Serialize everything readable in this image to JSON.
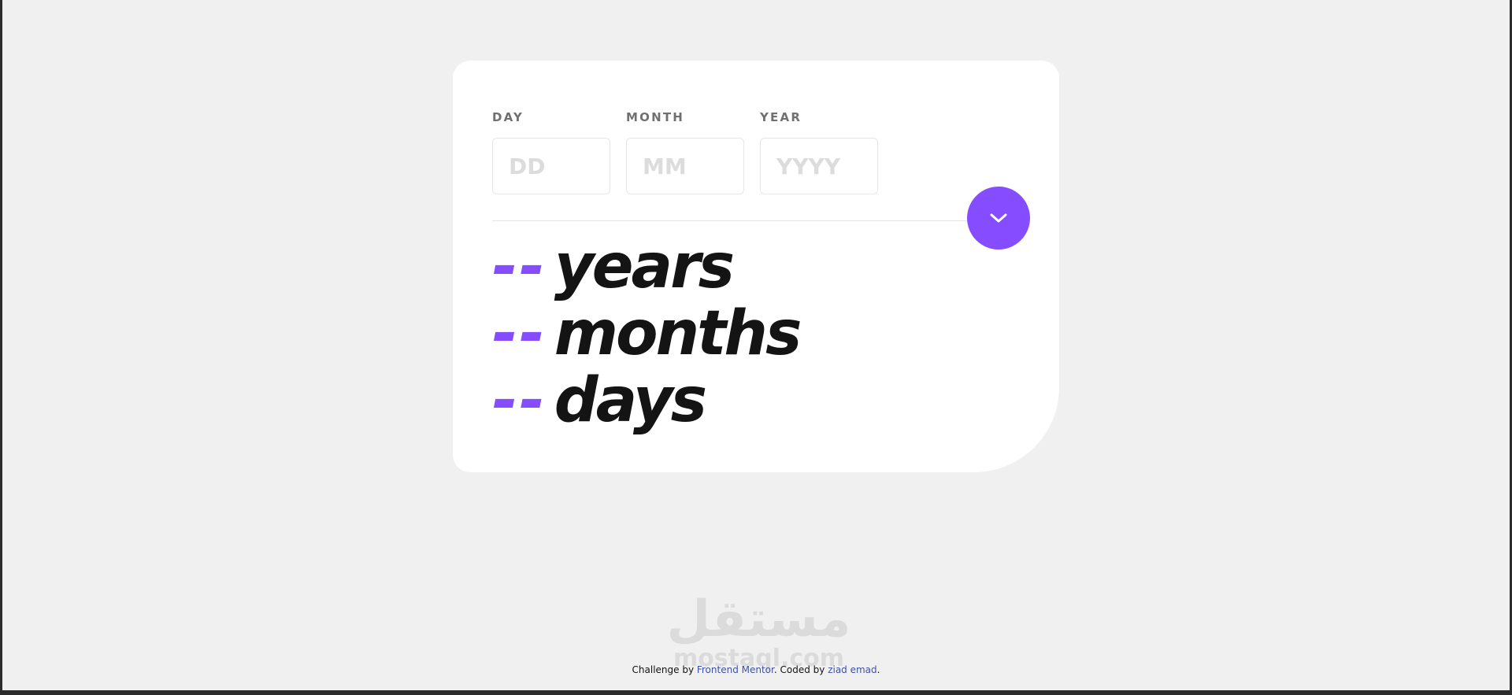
{
  "form": {
    "day": {
      "label": "DAY",
      "placeholder": "DD",
      "value": ""
    },
    "month": {
      "label": "MONTH",
      "placeholder": "MM",
      "value": ""
    },
    "year": {
      "label": "YEAR",
      "placeholder": "YYYY",
      "value": ""
    }
  },
  "submit": {
    "icon": "chevron-down-icon"
  },
  "results": {
    "years": {
      "value": "--",
      "unit": "years"
    },
    "months": {
      "value": "--",
      "unit": "months"
    },
    "days": {
      "value": "--",
      "unit": "days"
    }
  },
  "footer": {
    "prefix": "Challenge by ",
    "mentor_link": "Frontend Mentor",
    "middle": ". Coded by ",
    "author_link": "ziad emad",
    "suffix": "."
  },
  "watermark": {
    "arabic": "مستقل",
    "latin": "mostaql.com"
  },
  "colors": {
    "accent": "#854dff",
    "page_background": "#f0f0f0",
    "card_background": "#ffffff",
    "text_primary": "#141414",
    "label_text": "#716f6f",
    "placeholder": "#dcdcdc"
  }
}
